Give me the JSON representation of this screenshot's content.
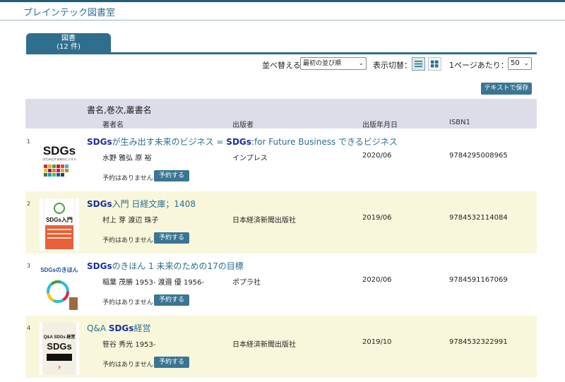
{
  "header": {
    "site_title": "プレインテック図書室"
  },
  "tab": {
    "label": "図書",
    "count": "(12 件)"
  },
  "controls": {
    "sort_label": "並べ替える：",
    "sort_value": "最初の並び順",
    "view_label": "表示切替：",
    "perpage_label": "1ページあたり：",
    "perpage_value": "50",
    "save_text_button": "テキストで保存"
  },
  "table": {
    "title_header": "書名,巻次,叢書名",
    "columns": [
      "著者名",
      "出版者",
      "出版年月日",
      "ISBN1"
    ]
  },
  "records": [
    {
      "num": "1",
      "title_pre": "",
      "title_kw": "SDGs",
      "title_mid": "が生み出す未来のビジネス = ",
      "title_kw2": "SDGs",
      "title_post": ":for Future Business できるビジネス",
      "author": "水野 雅弘 原 裕",
      "publisher": "インプレス",
      "date": "2020/06",
      "isbn": "9784295008965",
      "status": "予約はありません",
      "reserve": "予約する",
      "cover_text": "SDGs",
      "cover_sub": "が生み出す未来のビジネス"
    },
    {
      "num": "2",
      "title_pre": "",
      "title_kw": "SDGs",
      "title_mid": "入門 日経文庫；1408",
      "title_kw2": "",
      "title_post": "",
      "author": "村上 芽 渡辺 珠子",
      "publisher": "日本経済新聞出版社",
      "date": "2019/06",
      "isbn": "9784532114084",
      "status": "予約はありません",
      "reserve": "予約する",
      "cover_text": "SDGs入門",
      "cover_sub": ""
    },
    {
      "num": "3",
      "title_pre": "",
      "title_kw": "SDGs",
      "title_mid": "のきほん 1 未来のための17の目標",
      "title_kw2": "",
      "title_post": "",
      "author": "稲葉 茂勝 1953- 渡邉 優 1956-",
      "publisher": "ポプラ社",
      "date": "2020/06",
      "isbn": "9784591167069",
      "status": "予約はありません",
      "reserve": "予約する",
      "cover_text": "SDGsのきほん",
      "cover_sub": ""
    },
    {
      "num": "4",
      "title_pre": "Q&A ",
      "title_kw": "SDGs",
      "title_mid": "経営",
      "title_kw2": "",
      "title_post": "",
      "author": "笹谷 秀光 1953-",
      "publisher": "日本経済新聞出版社",
      "date": "2019/10",
      "isbn": "9784532322991",
      "status": "予約はありません",
      "reserve": "予約する",
      "cover_text": "Q&A SDGs 経営",
      "cover_sub": ""
    }
  ]
}
